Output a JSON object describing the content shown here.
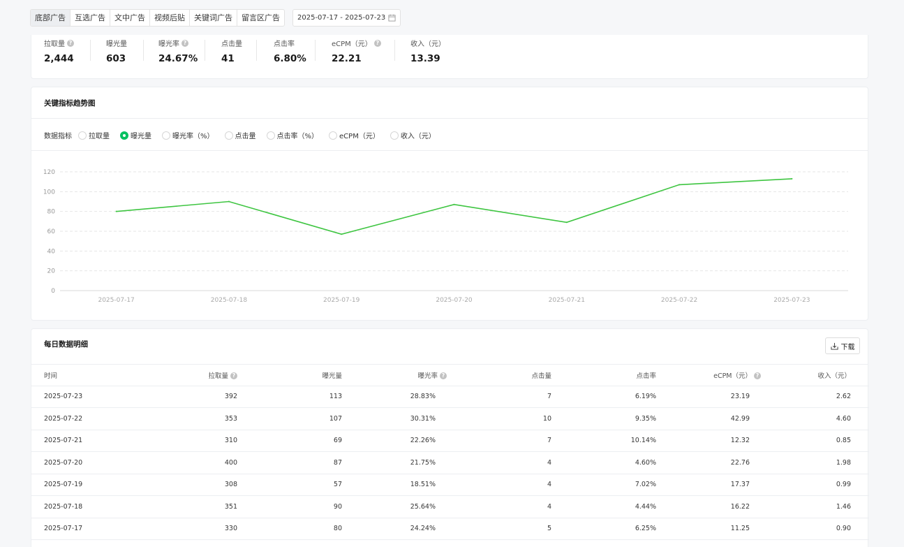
{
  "tabs": [
    "底部广告",
    "互选广告",
    "文中广告",
    "视频后贴",
    "关键词广告",
    "留言区广告"
  ],
  "active_tab": 0,
  "date_range": "2025-07-17 - 2025-07-23",
  "summary": [
    {
      "label": "拉取量",
      "value": "2,444",
      "help": true
    },
    {
      "label": "曝光量",
      "value": "603",
      "help": false
    },
    {
      "label": "曝光率",
      "value": "24.67%",
      "help": true
    },
    {
      "label": "点击量",
      "value": "41",
      "help": false
    },
    {
      "label": "点击率",
      "value": "6.80%",
      "help": false
    },
    {
      "label": "eCPM（元）",
      "value": "22.21",
      "help": true
    },
    {
      "label": "收入（元）",
      "value": "13.39",
      "help": false
    }
  ],
  "trend": {
    "title": "关键指标趋势图",
    "metric_label": "数据指标",
    "metrics": [
      "拉取量",
      "曝光量",
      "曝光率（%）",
      "点击量",
      "点击率（%）",
      "eCPM（元）",
      "收入（元）"
    ],
    "selected_metric": 1
  },
  "chart_data": {
    "type": "line",
    "x": [
      "2025-07-17",
      "2025-07-18",
      "2025-07-19",
      "2025-07-20",
      "2025-07-21",
      "2025-07-22",
      "2025-07-23"
    ],
    "series": [
      {
        "values": [
          80,
          90,
          57,
          87,
          69,
          107,
          113
        ]
      }
    ],
    "y_ticks": [
      0,
      20,
      40,
      60,
      80,
      100,
      120
    ],
    "ylim": [
      0,
      120
    ],
    "grid": true,
    "color": "#3ec541"
  },
  "daily": {
    "title": "每日数据明细",
    "download_label": "下载",
    "columns": [
      {
        "label": "时间",
        "help": false
      },
      {
        "label": "拉取量",
        "help": true
      },
      {
        "label": "曝光量",
        "help": false
      },
      {
        "label": "曝光率",
        "help": true
      },
      {
        "label": "点击量",
        "help": false
      },
      {
        "label": "点击率",
        "help": false
      },
      {
        "label": "eCPM（元）",
        "help": true
      },
      {
        "label": "收入（元）",
        "help": false
      }
    ],
    "rows": [
      [
        "2025-07-23",
        "392",
        "113",
        "28.83%",
        "7",
        "6.19%",
        "23.19",
        "2.62"
      ],
      [
        "2025-07-22",
        "353",
        "107",
        "30.31%",
        "10",
        "9.35%",
        "42.99",
        "4.60"
      ],
      [
        "2025-07-21",
        "310",
        "69",
        "22.26%",
        "7",
        "10.14%",
        "12.32",
        "0.85"
      ],
      [
        "2025-07-20",
        "400",
        "87",
        "21.75%",
        "4",
        "4.60%",
        "22.76",
        "1.98"
      ],
      [
        "2025-07-19",
        "308",
        "57",
        "18.51%",
        "4",
        "7.02%",
        "17.37",
        "0.99"
      ],
      [
        "2025-07-18",
        "351",
        "90",
        "25.64%",
        "4",
        "4.44%",
        "16.22",
        "1.46"
      ],
      [
        "2025-07-17",
        "330",
        "80",
        "24.24%",
        "5",
        "6.25%",
        "11.25",
        "0.90"
      ]
    ]
  }
}
